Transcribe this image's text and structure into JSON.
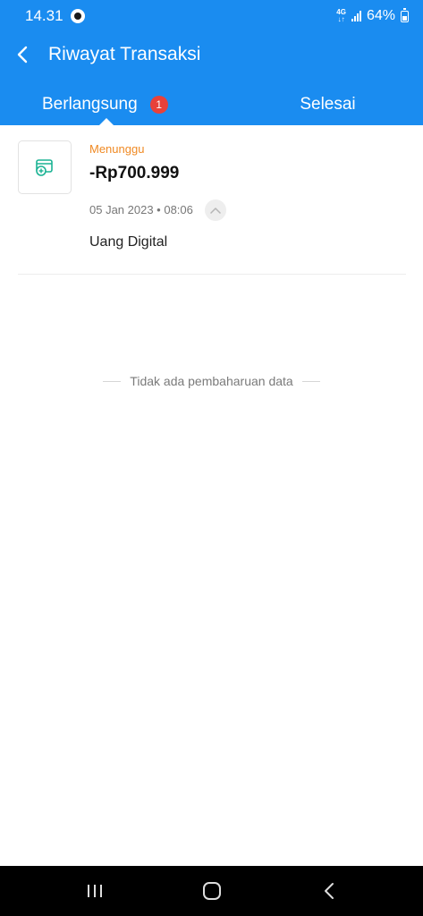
{
  "status_bar": {
    "time": "14.31",
    "network_top": "4G",
    "network_bottom": "↓↑",
    "battery": "64%"
  },
  "header": {
    "title": "Riwayat Transaksi",
    "back_icon": "chevron-left-icon"
  },
  "tabs": [
    {
      "label": "Berlangsung",
      "badge": "1",
      "active": true
    },
    {
      "label": "Selesai",
      "active": false
    }
  ],
  "transactions": [
    {
      "status": "Menunggu",
      "amount": "-Rp700.999",
      "datetime": "05 Jan 2023 • 08:06",
      "type": "Uang Digital",
      "icon": "digital-wallet-icon"
    }
  ],
  "empty_notice": "Tidak ada pembaharuan data",
  "colors": {
    "primary": "#1a8cf0",
    "badge": "#e8413a",
    "pending": "#f08a24",
    "icon_accent": "#1bb394"
  },
  "nav": {
    "recents_icon": "recents-icon",
    "home_icon": "home-icon",
    "back_icon": "back-icon"
  }
}
